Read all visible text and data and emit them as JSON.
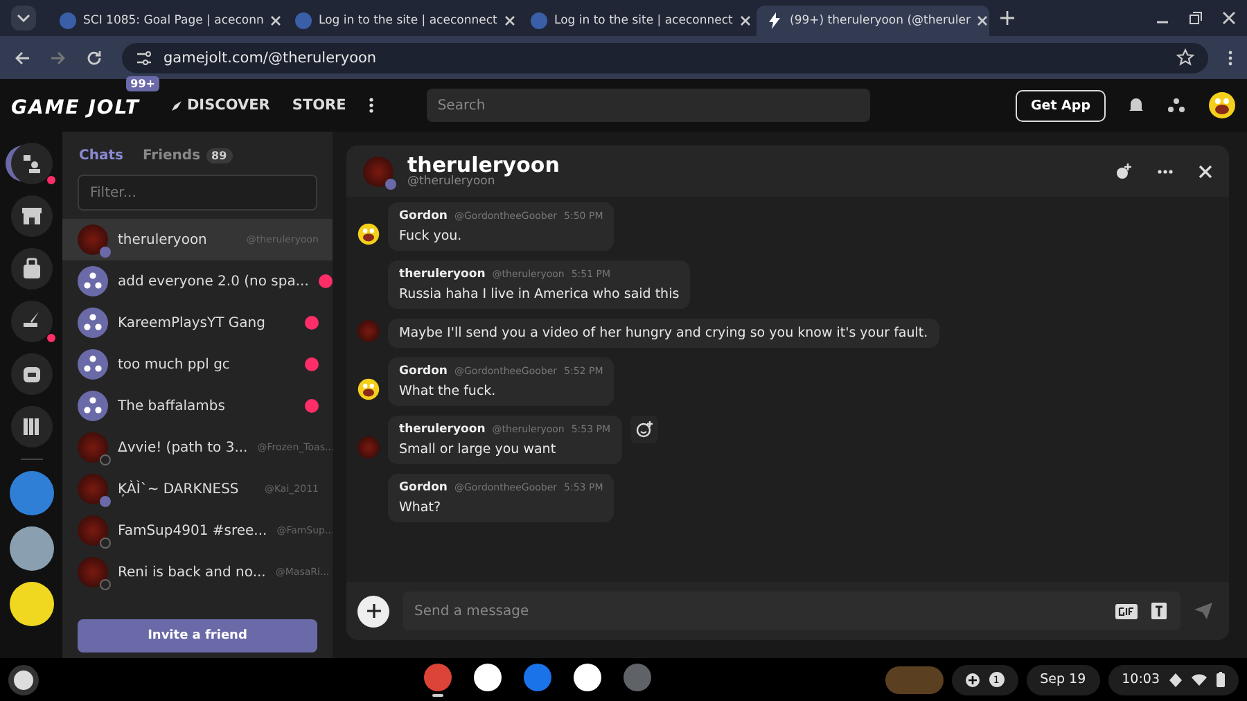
{
  "browser": {
    "tabs": [
      {
        "title": "SCI 1085: Goal Page | aceconn",
        "selected": false
      },
      {
        "title": "Log in to the site | aceconnect",
        "selected": false
      },
      {
        "title": "Log in to the site | aceconnect",
        "selected": false
      },
      {
        "title": "(99+) theruleryoon (@theruler",
        "selected": true
      }
    ],
    "url": "gamejolt.com/@theruleryoon"
  },
  "topbar": {
    "logo": "GAME JOLT",
    "badge": "99+",
    "nav": [
      "DISCOVER",
      "STORE"
    ],
    "search": {
      "placeholder": "Search"
    },
    "get_app": "Get App"
  },
  "rail": [
    {
      "kind": "chat",
      "notify": true,
      "selected": true
    },
    {
      "kind": "store",
      "notify": false,
      "selected": false
    },
    {
      "kind": "bag",
      "notify": false,
      "selected": false
    },
    {
      "kind": "quest",
      "notify": true,
      "selected": false
    },
    {
      "kind": "bot",
      "notify": false,
      "selected": false
    },
    {
      "kind": "library",
      "notify": false,
      "selected": false
    }
  ],
  "rail_communities": [
    {
      "color": "#2f7fd6"
    },
    {
      "color": "#8aa0b0"
    },
    {
      "color": "#f0d820"
    }
  ],
  "chat_list": {
    "tabs": [
      {
        "label": "Chats",
        "selected": true
      },
      {
        "label": "Friends",
        "count": "89",
        "selected": false
      }
    ],
    "filter": {
      "placeholder": "Filter..."
    },
    "items": [
      {
        "kind": "user",
        "name": "theruleryoon",
        "handle": "@theruleryoon",
        "selected": true,
        "online": true
      },
      {
        "kind": "group",
        "name": "add everyone 2.0 (no spa...",
        "selected": false,
        "unread": true
      },
      {
        "kind": "group",
        "name": "KareemPlaysYT Gang",
        "selected": false,
        "unread": true
      },
      {
        "kind": "group",
        "name": "too much ppl gc",
        "selected": false,
        "unread": true
      },
      {
        "kind": "group",
        "name": "The baffalambs",
        "selected": false,
        "unread": true
      },
      {
        "kind": "user",
        "name": "Δvvie! (path to 3...",
        "handle": "@Frozen_Toas...",
        "selected": false,
        "online": false
      },
      {
        "kind": "user",
        "name": "ĶÀÌ`~ DARKNESS",
        "handle": "@Kai_2011",
        "selected": false,
        "online": true
      },
      {
        "kind": "user",
        "name": "FamSup4901 #sree...",
        "handle": "@FamSup...",
        "selected": false,
        "online": false
      },
      {
        "kind": "user",
        "name": "Reni is back and no...",
        "handle": "@MasaRi...",
        "selected": false,
        "online": false
      }
    ],
    "invite": "Invite a friend"
  },
  "chat": {
    "title": "theruleryoon",
    "handle": "@theruleryoon",
    "messages": [
      {
        "author": "Gordon",
        "handle": "@GordontheeGoober",
        "time": "5:50 PM",
        "text": "Fuck you.",
        "kind": "smiley"
      },
      {
        "author": "theruleryoon",
        "handle": "@theruleryoon",
        "time": "5:51 PM",
        "text": "Russia haha I live in America who said this",
        "kind": "plain"
      },
      {
        "text": "Maybe I'll send you a video of her hungry and crying so you know it's your fault.",
        "kind": "dark"
      },
      {
        "author": "Gordon",
        "handle": "@GordontheeGoober",
        "time": "5:52 PM",
        "text": "What the fuck.",
        "kind": "smiley"
      },
      {
        "author": "theruleryoon",
        "handle": "@theruleryoon",
        "time": "5:53 PM",
        "text": "Small or large you want",
        "kind": "dark",
        "hovered": true
      },
      {
        "author": "Gordon",
        "handle": "@GordontheeGoober",
        "time": "5:53 PM",
        "text": "What?",
        "kind": "plain"
      }
    ],
    "input": {
      "placeholder": "Send a message"
    }
  },
  "taskbar": {
    "apps": [
      {
        "kind": "chrome",
        "selected": true
      },
      {
        "kind": "gmail",
        "selected": false
      },
      {
        "kind": "files",
        "selected": false
      },
      {
        "kind": "messenger",
        "selected": false
      },
      {
        "kind": "settings",
        "selected": false
      }
    ],
    "notifications": "1",
    "date": "Sep 19",
    "time": "10:03"
  }
}
